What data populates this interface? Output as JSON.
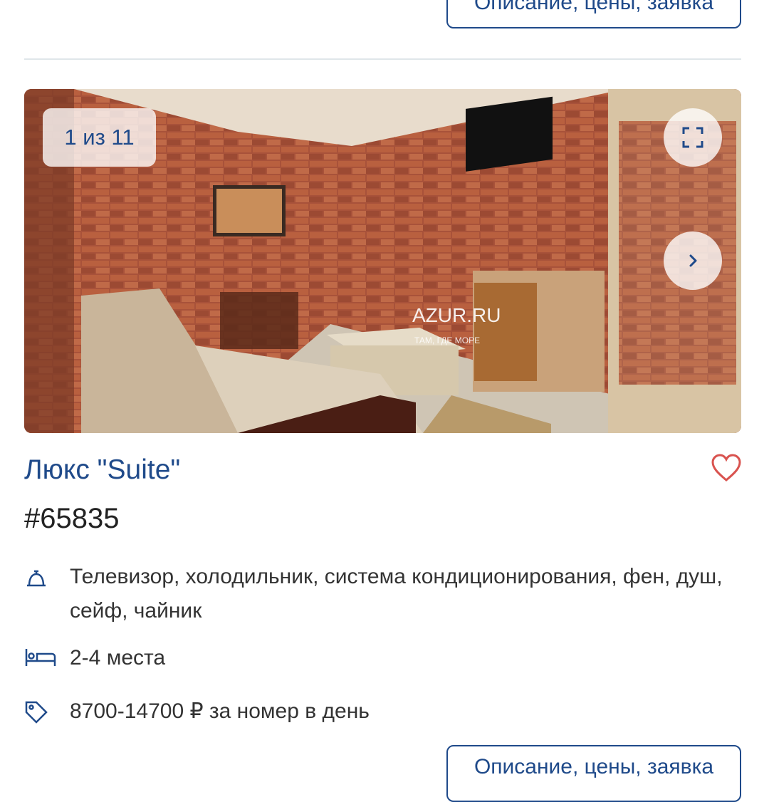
{
  "buttons": {
    "details_label": "Описание, цены, заявка"
  },
  "gallery": {
    "counter": "1 из 11",
    "watermark_brand": "AZUR.RU",
    "watermark_slogan": "ТАМ, ГДЕ МОРЕ"
  },
  "room": {
    "title": "Люкс \"Suite\"",
    "id": "#65835",
    "amenities": "Телевизор, холодильник, система кондиционирования, фен, душ, сейф, чайник",
    "capacity": "2-4 места",
    "price": "8700-14700 ₽ за номер в день"
  },
  "icons": {
    "amenities": "bell-icon",
    "capacity": "bed-icon",
    "price": "tag-icon",
    "favorite": "heart-icon",
    "fullscreen": "fullscreen-icon",
    "next": "chevron-right-icon"
  },
  "colors": {
    "accent": "#1f4a8a",
    "favorite": "#d9534f",
    "divider": "#dfe6ea"
  }
}
